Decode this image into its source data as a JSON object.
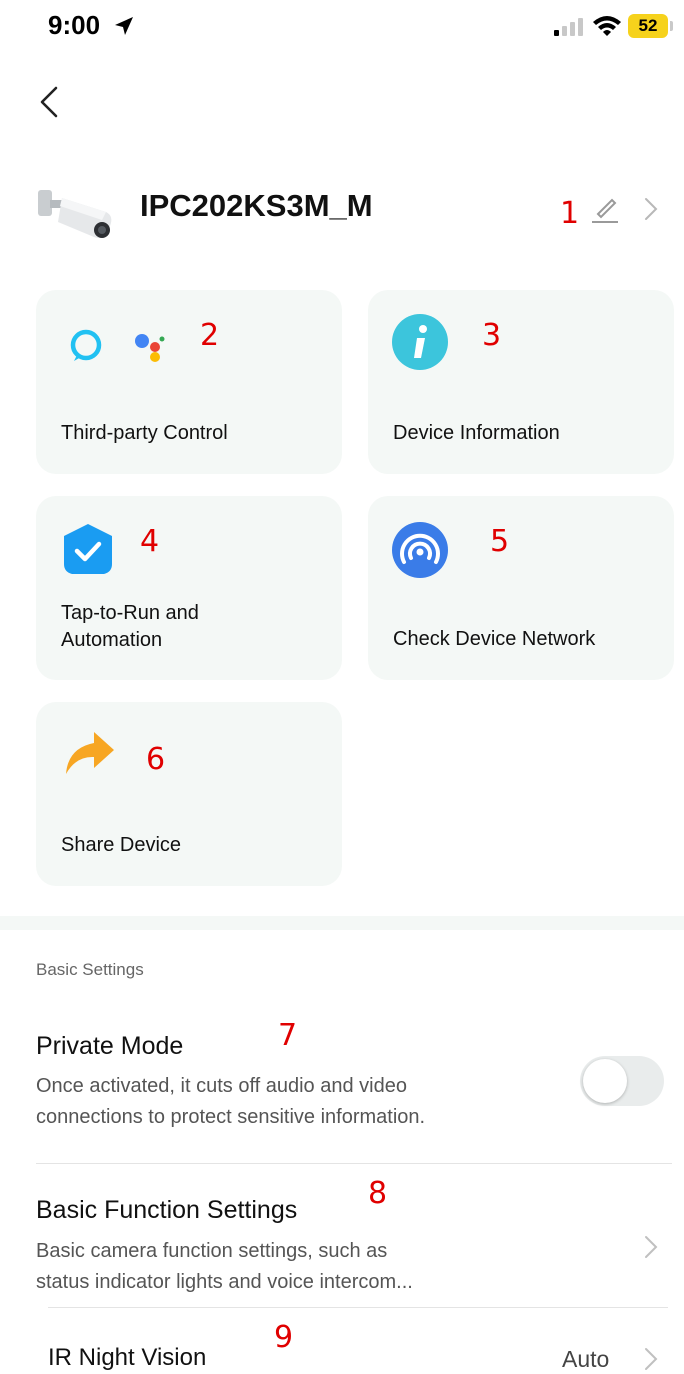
{
  "status_bar": {
    "time": "9:00",
    "battery": "52",
    "icons": [
      "location-arrow-icon",
      "cellular-signal-icon",
      "wifi-icon",
      "battery-icon"
    ]
  },
  "header": {
    "device_name": "IPC202KS3M_M"
  },
  "cards": [
    {
      "label": "Third-party Control",
      "icon": "alexa-google-assistant-icons"
    },
    {
      "label": "Device Information",
      "icon": "info-icon"
    },
    {
      "label": "Tap-to-Run and Automation",
      "icon": "automation-check-icon"
    },
    {
      "label": "Check Device Network",
      "icon": "network-signal-icon"
    },
    {
      "label": "Share Device",
      "icon": "share-arrow-icon"
    }
  ],
  "annotations": [
    "1",
    "2",
    "3",
    "4",
    "5",
    "6",
    "7",
    "8",
    "9"
  ],
  "basic_settings": {
    "title": "Basic Settings",
    "private_mode": {
      "title": "Private Mode",
      "desc_line1": "Once activated, it cuts off audio and video",
      "desc_line2": "connections to protect sensitive information.",
      "enabled": false
    },
    "basic_function": {
      "title": "Basic Function Settings",
      "desc_line1": "Basic camera function settings, such as",
      "desc_line2": "status indicator lights and voice intercom..."
    },
    "ir_night_vision": {
      "title": "IR Night Vision",
      "value": "Auto"
    }
  },
  "colors": {
    "card_bg": "#f4f8f6",
    "annotation": "#e00000",
    "battery": "#f6d21c",
    "info_icon": "#3cc5dc",
    "automation_icon": "#1a9cf2",
    "network_icon": "#3a7ce8",
    "share_icon": "#f7a623"
  }
}
